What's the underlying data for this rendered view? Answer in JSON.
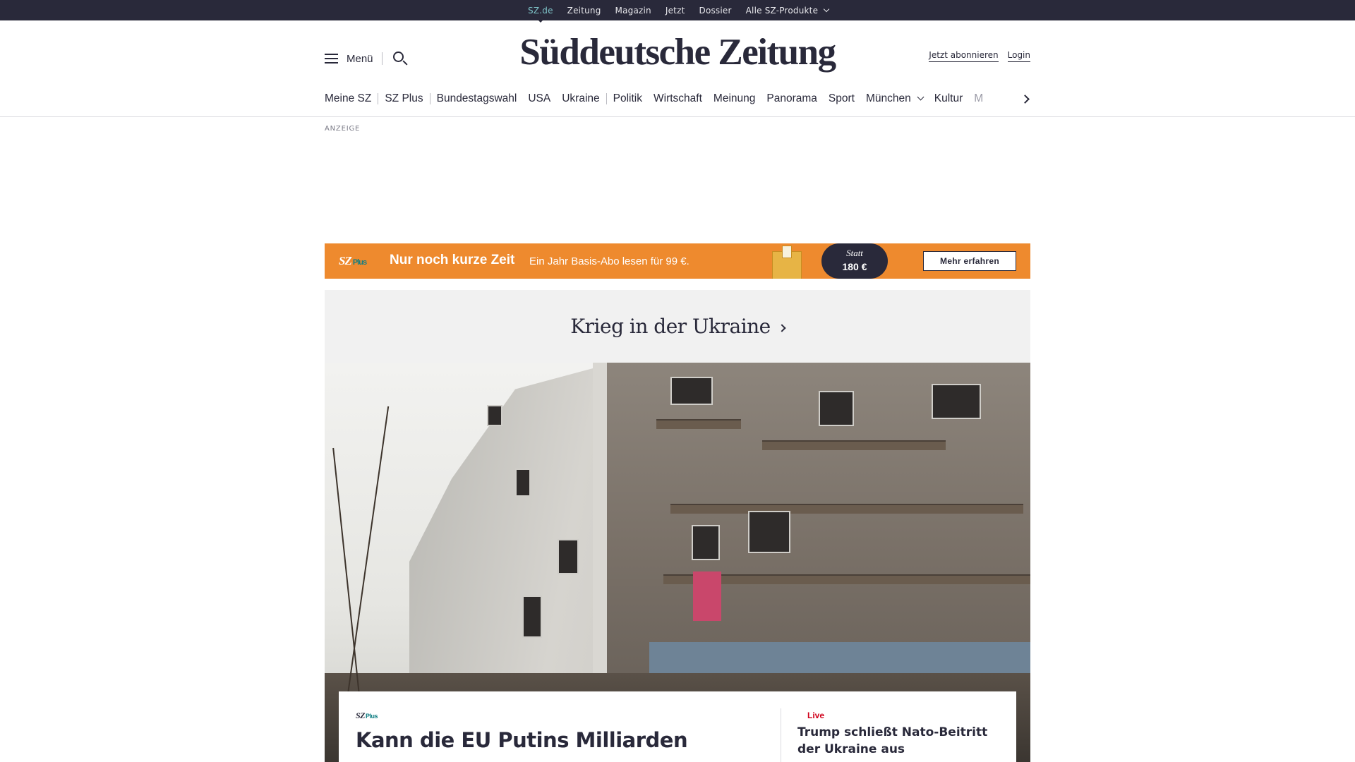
{
  "topbar": {
    "links": [
      "SZ.de",
      "Zeitung",
      "Magazin",
      "Jetzt",
      "Dossier",
      "Alle SZ-Produkte"
    ]
  },
  "header": {
    "menu_label": "Menü",
    "logo": "Süddeutsche Zeitung",
    "subscribe_label": "Jetzt abonnieren",
    "login_label": "Login"
  },
  "nav": {
    "items": [
      "Meine SZ",
      "SZ Plus",
      "Bundestagswahl",
      "USA",
      "Ukraine",
      "Politik",
      "Wirtschaft",
      "Meinung",
      "Panorama",
      "Sport",
      "München",
      "Kultur",
      "M"
    ]
  },
  "ad": {
    "label": "ANZEIGE"
  },
  "promo": {
    "brand": "SZ",
    "brand_suffix": "Plus",
    "headline": "Nur noch kurze Zeit",
    "subline": "Ein Jahr Basis-Abo lesen für 99 €.",
    "statt_label": "Statt",
    "statt_price": "180 €",
    "cta_label": "Mehr erfahren",
    "color": "#ee8a2e"
  },
  "topic": {
    "title": "Krieg in der Ukraine"
  },
  "teaser": {
    "badge_brand": "SZ",
    "badge_suffix": "Plus",
    "headline": "Kann die EU Putins Milliarden",
    "live_label": "Live",
    "live_headline": "Trump schließt Nato-Beitritt der Ukraine aus"
  },
  "colors": {
    "dark": "#29293a",
    "accent_teal": "#7fc4c9",
    "plus_teal": "#0f7e83",
    "live_red": "#d0021b"
  }
}
